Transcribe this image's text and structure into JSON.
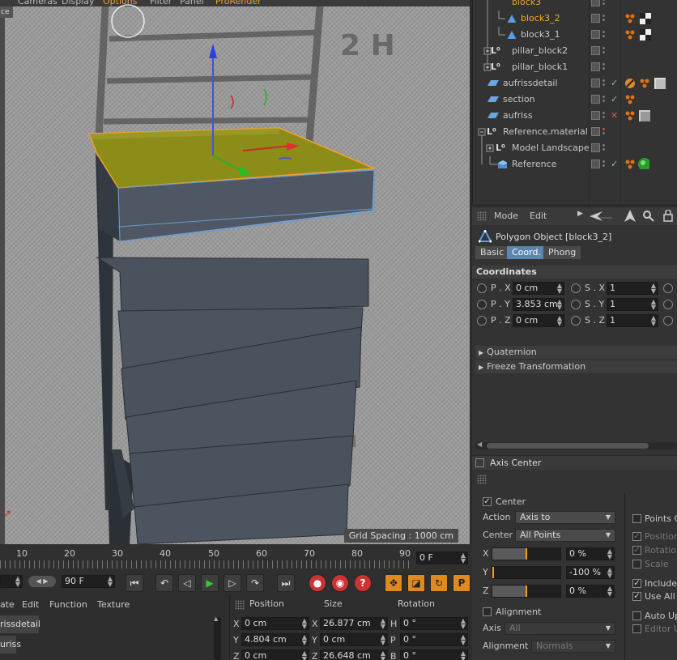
{
  "viewport": {
    "menu": [
      "Cameras",
      "Display",
      "Options",
      "Filter",
      "Panel",
      "ProRender"
    ],
    "view_label": "ce",
    "grid_spacing": "Grid Spacing : 1000 cm",
    "wall_text": "2 H",
    "wall_text_small": "H"
  },
  "object_manager": {
    "objects": [
      {
        "name": "block3",
        "selected": true
      },
      {
        "name": "block3_2",
        "selected": true
      },
      {
        "name": "block3_1",
        "selected": false
      },
      {
        "name": "pillar_block2",
        "selected": false
      },
      {
        "name": "pillar_block1",
        "selected": false
      },
      {
        "name": "aufrissdetail",
        "selected": false
      },
      {
        "name": "section",
        "selected": false
      },
      {
        "name": "aufriss",
        "selected": false
      },
      {
        "name": "Reference.material",
        "selected": false
      },
      {
        "name": "Model Landscape",
        "selected": false
      },
      {
        "name": "Reference",
        "selected": false
      }
    ]
  },
  "attribute_manager": {
    "menu_mode": "Mode",
    "menu_edit": "Edit",
    "object_title": "Polygon Object [block3_2]",
    "tabs": [
      "Basic",
      "Coord.",
      "Phong"
    ],
    "active_tab": "Coord.",
    "section": "Coordinates",
    "coords": {
      "px_label": "P . X",
      "px": "0 cm",
      "py_label": "P . Y",
      "py": "3.853 cm",
      "pz_label": "P . Z",
      "pz": "0 cm",
      "sx_label": "S . X",
      "sx": "1",
      "sy_label": "S . Y",
      "sy": "1",
      "sz_label": "S . Z",
      "sz": "1"
    },
    "folds": [
      "Quaternion",
      "Freeze Transformation"
    ]
  },
  "axis_center": {
    "title": "Axis Center",
    "center_label": "Center",
    "center_checked": true,
    "action_label": "Action",
    "action_value": "Axis to",
    "center2_label": "Center",
    "center2_value": "All Points",
    "x_label": "X",
    "x_value": "0 %",
    "x_level": 0.5,
    "y_label": "Y",
    "y_value": "-100 %",
    "y_level": 0.0,
    "z_label": "Z",
    "z_value": "0 %",
    "z_level": 0.5,
    "alignment_label": "Alignment",
    "axis_label": "Axis",
    "axis_value": "All",
    "alignment2_label": "Alignment",
    "alignment2_value": "Normals",
    "right_options": {
      "points_center": "Points C",
      "position": "Position",
      "rotation": "Rotation",
      "scale": "Scale",
      "include": "Include",
      "use_all": "Use All C",
      "auto_update": "Auto Up",
      "editor_update": "Editor U"
    }
  },
  "timeline": {
    "ticks": [
      "10",
      "20",
      "30",
      "40",
      "50",
      "60",
      "70",
      "80",
      "90"
    ],
    "current_frame": "0 F",
    "end_frame": "90 F"
  },
  "material_manager": {
    "menu": [
      "ate",
      "Edit",
      "Function",
      "Texture"
    ],
    "items": [
      "rissdetail",
      "uriss"
    ]
  },
  "coordinate_manager": {
    "headers": [
      "Position",
      "Size",
      "Rotation"
    ],
    "rows": [
      {
        "axis1": "X",
        "pos": "0 cm",
        "axis2": "X",
        "size": "26.877 cm",
        "axis3": "H",
        "rot": "0 °"
      },
      {
        "axis1": "Y",
        "pos": "4.804 cm",
        "axis2": "Y",
        "size": "0 cm",
        "axis3": "P",
        "rot": "0 °"
      },
      {
        "axis1": "Z",
        "pos": "0 cm",
        "axis2": "Z",
        "size": "26.648 cm",
        "axis3": "B",
        "rot": "0 °"
      }
    ]
  },
  "colors": {
    "accent_orange": "#f0a030",
    "selection_yellow": "#8a8a10",
    "active_tab_blue": "#5a86b0"
  }
}
